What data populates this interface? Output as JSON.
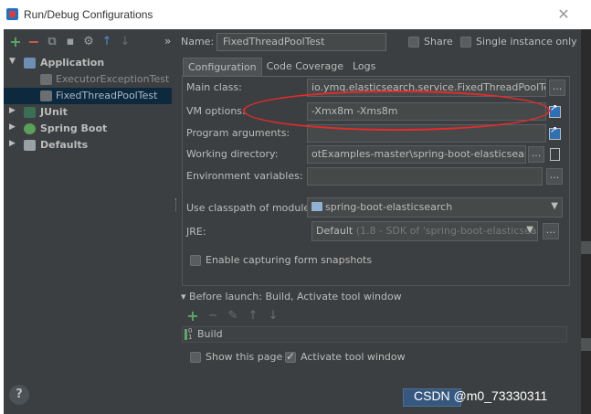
{
  "window": {
    "title": "Run/Debug Configurations",
    "close_glyph": "✕"
  },
  "toolbar": {
    "add": "+",
    "remove": "−",
    "copy": "⧉",
    "save": "▪",
    "wrench": "⚙",
    "move_up": "↑",
    "move_down": "↓",
    "more": "»"
  },
  "name_row": {
    "label": "Name:",
    "value": "FixedThreadPoolTest",
    "share_label": "Share",
    "single_instance_label": "Single instance only"
  },
  "tree": {
    "items": [
      {
        "label": "Application",
        "toggle": "▼"
      },
      {
        "label": "ExecutorExceptionTest"
      },
      {
        "label": "FixedThreadPoolTest"
      },
      {
        "label": "JUnit",
        "toggle": "▶"
      },
      {
        "label": "Spring Boot",
        "toggle": "▶"
      },
      {
        "label": "Defaults",
        "toggle": "▶"
      }
    ]
  },
  "tabs": [
    {
      "label": "Configuration"
    },
    {
      "label": "Code Coverage"
    },
    {
      "label": "Logs"
    }
  ],
  "config": {
    "main_class": {
      "label": "Main class:",
      "value": "io.ymq.elasticsearch.service.FixedThreadPoolTest",
      "browse": "..."
    },
    "vm_options": {
      "label": "VM options:",
      "value": "-Xmx8m -Xms8m"
    },
    "program_arguments": {
      "label": "Program arguments:",
      "value": ""
    },
    "working_directory": {
      "label": "Working directory:",
      "value": "otExamples-master\\spring-boot-elasticsearch",
      "browse": "..."
    },
    "environment_variables": {
      "label": "Environment variables:",
      "value": "",
      "browse": "..."
    },
    "classpath_module": {
      "label": "Use classpath of module:",
      "value": "spring-boot-elasticsearch",
      "arrow": "▼"
    },
    "jre": {
      "label": "JRE:",
      "value": "Default",
      "detail": "(1.8 - SDK of 'spring-boot-elasticsear",
      "arrow": "▼",
      "browse": "..."
    },
    "form_snapshots_label": "Enable capturing form snapshots"
  },
  "before_launch": {
    "header": "▾ Before launch: Build, Activate tool window",
    "tools": {
      "add": "+",
      "remove": "−",
      "edit": "✎",
      "up": "↑",
      "down": "↓"
    },
    "task": "Build",
    "show_page_label": "Show this page",
    "activate_tool_window_label": "Activate tool window"
  },
  "footer": {
    "help": "?",
    "watermark": "CSDN @m0_73330311"
  },
  "colors": {
    "dialog_bg": "#3c3f41",
    "selection": "#0d293e",
    "annotation_red": "#e52b2b",
    "ok_button": "#365880"
  }
}
